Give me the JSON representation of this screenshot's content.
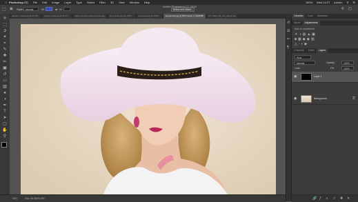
{
  "menubar": {
    "apple": "",
    "app": "Photoshop CC",
    "items": [
      "File",
      "Edit",
      "Image",
      "Layer",
      "Type",
      "Select",
      "Filter",
      "3D",
      "View",
      "Window",
      "Help"
    ],
    "right": {
      "battery": "100%",
      "time": "Wed 14:27",
      "user": "juhohn"
    }
  },
  "options": {
    "style_label": "Style:",
    "style_value": "Normal",
    "width_label": "W:",
    "height_label": "H:",
    "select_mask_button": "Select and Mask...",
    "doc_title": "Adobe Photoshop CC 2015"
  },
  "tabs": [
    {
      "label": "glamour_tinted.jpg @ 33.3%...",
      "active": false
    },
    {
      "label": "leather-shoe.jpg @ 66.7%...",
      "active": false
    },
    {
      "label": "labo-mountain-shield-bed-art.jpg",
      "active": false
    },
    {
      "label": "brine-alone.jpg @ 100%...",
      "active": false
    },
    {
      "label": "Everyday.jpg @ 100%...",
      "active": false
    },
    {
      "label": "woman-hat.jpg @ 50% (Layer 1, RGB/8#)",
      "active": true
    },
    {
      "label": "CS_Page_08_roll_effects.psd",
      "active": false
    }
  ],
  "statusbar": {
    "zoom": "50%",
    "doc_info": "Doc: 46.3M/92.6M"
  },
  "panels": {
    "top_tabs": [
      "Libraries",
      "Color",
      "Swatches"
    ],
    "mid_tabs": [
      "Styles",
      "Adjustments"
    ],
    "adjustments_hint": "Add an adjustment",
    "layer_tabs": [
      "Channels",
      "Paths",
      "Layers"
    ],
    "kind_label": "Kind",
    "blend_mode": "Normal",
    "opacity_label": "Opacity:",
    "opacity": "100%",
    "lock_label": "Lock:",
    "fill_label": "Fill:",
    "fill": "100%",
    "layers": [
      {
        "name": "Layer 1",
        "thumb": "#000000",
        "selected": true
      },
      {
        "name": "Background",
        "thumb": "#d9c7b0",
        "selected": false
      }
    ]
  },
  "colors": {
    "menubar": "#2b2b2b",
    "chrome": "#3c3c3c",
    "canvas_bg": "#535353",
    "hat": "#f2e3ef",
    "band": "#2a1e18",
    "chain": "#c9a24a",
    "lips": "#b4295a"
  }
}
